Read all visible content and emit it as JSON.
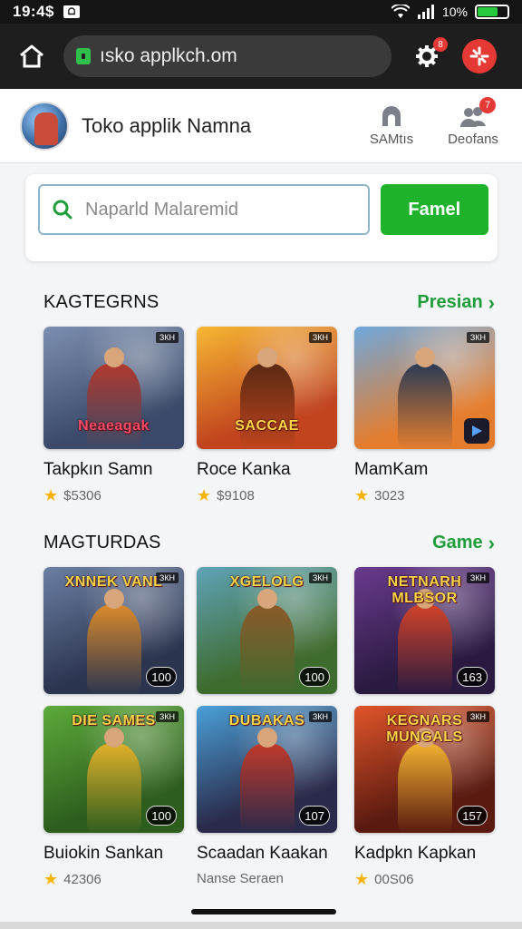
{
  "status_bar": {
    "time": "19:4$",
    "notif_glyph": "ᗝ",
    "battery_label": "10%",
    "battery_level": 0.7
  },
  "browser": {
    "url": "ısko applkch.om",
    "gear_badge": "8"
  },
  "header": {
    "title": "Toko applik  Namna",
    "actions": [
      {
        "label": "SAMtıs"
      },
      {
        "label": "Deofans",
        "badge": "7"
      }
    ]
  },
  "search": {
    "placeholder": "Naparld Malaremid",
    "button_label": "Famel"
  },
  "section1": {
    "title": "KAGTEGRNS",
    "link": "Presian",
    "items": [
      {
        "name": "Takpkın Samn",
        "price": "$5306",
        "art_title": "Neaeagak",
        "tag": "ЗКН",
        "colors": [
          "#7d8fb0",
          "#3b4a6a",
          "#b0392d"
        ]
      },
      {
        "name": "Roce Kanka",
        "price": "$9108",
        "art_title": "SACCAE",
        "tag": "ЗКН",
        "colors": [
          "#f7b733",
          "#c1441e",
          "#5a2a12"
        ]
      },
      {
        "name": "MamKam",
        "price": "3023",
        "art_title": "",
        "tag": "ЗКН",
        "colors": [
          "#6fa8dc",
          "#e47d2e",
          "#2a3b55"
        ]
      }
    ]
  },
  "section2": {
    "title": "MAGTURDAS",
    "link": "Game",
    "items": [
      {
        "art_title": "XNNEK VANL",
        "tag": "ЗКН",
        "badge": "100",
        "colors": [
          "#6b7fa3",
          "#2c3550",
          "#d98a2b"
        ]
      },
      {
        "art_title": "XGELOLG",
        "tag": "ЗКН",
        "badge": "100",
        "colors": [
          "#5fa3b8",
          "#3e6b2e",
          "#8c5a2b"
        ]
      },
      {
        "art_title": "NETNARH MLBSOR",
        "tag": "ЗКН",
        "badge": "163",
        "colors": [
          "#6a3a8e",
          "#2a1a40",
          "#d0422a"
        ]
      },
      {
        "name": "Buiokin Sankan",
        "price": "42306",
        "art_title": "DIE SAMES",
        "tag": "ЗКН",
        "badge": "100",
        "colors": [
          "#5caa3a",
          "#2e5e1e",
          "#e0b02a"
        ]
      },
      {
        "name": "Scaadan Kaakan",
        "price": "Nanse Seraen",
        "art_title": "DUBAKAS",
        "tag": "ЗКН",
        "badge": "107",
        "colors": [
          "#4aa0d8",
          "#2a2a4a",
          "#c0392b"
        ]
      },
      {
        "name": "Kadpkn Kapkan",
        "price": "00S06",
        "art_title": "KEGNARS MUNGALS",
        "tag": "ЗКН",
        "badge": "157",
        "colors": [
          "#e0552a",
          "#5a1a10",
          "#f0b030"
        ]
      }
    ]
  }
}
